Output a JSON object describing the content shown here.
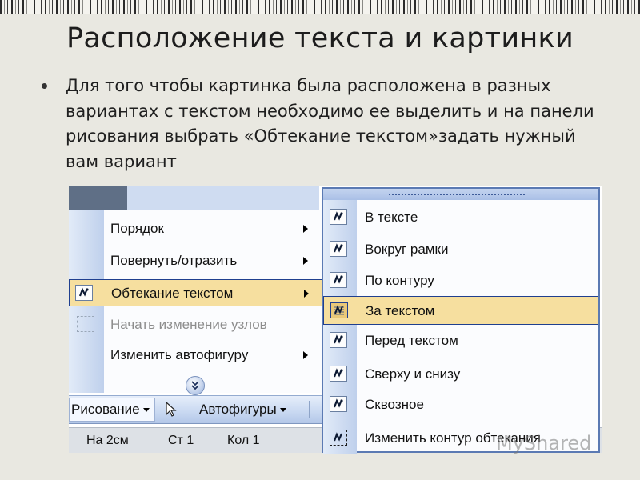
{
  "slide": {
    "title": "Расположение текста и картинки",
    "bullet": "Для того чтобы картинка была расположена в разных вариантах с текстом необходимо ее выделить и на панели рисования выбрать «Обтекание текстом»задать нужный вам вариант"
  },
  "context_menu": {
    "items": [
      {
        "label": "Порядок",
        "has_submenu": true,
        "enabled": true
      },
      {
        "label": "Повернуть/отразить",
        "has_submenu": true,
        "enabled": true
      },
      {
        "label": "Обтекание текстом",
        "has_submenu": true,
        "enabled": true,
        "selected": true
      },
      {
        "label": "Начать изменение узлов",
        "has_submenu": false,
        "enabled": false
      },
      {
        "label": "Изменить автофигуру",
        "has_submenu": true,
        "enabled": true
      }
    ],
    "expand_icon": "double-chevron-down-icon"
  },
  "toolbar": {
    "drawing_label": "Рисование",
    "autoshapes_label": "Автофигуры",
    "cursor_icon": "arrow-cursor-icon"
  },
  "statusbar": {
    "position": "На 2см",
    "line": "Ст 1",
    "column": "Кол 1"
  },
  "wrap_submenu": {
    "items": [
      {
        "label": "В тексте",
        "icon": "inline-wrap-icon"
      },
      {
        "label": "Вокруг рамки",
        "icon": "square-wrap-icon"
      },
      {
        "label": "По контуру",
        "icon": "tight-wrap-icon"
      },
      {
        "label": "За текстом",
        "icon": "behind-text-icon",
        "selected": true
      },
      {
        "label": "Перед текстом",
        "icon": "in-front-text-icon"
      },
      {
        "label": "Сверху и снизу",
        "icon": "top-bottom-wrap-icon"
      },
      {
        "label": "Сквозное",
        "icon": "through-wrap-icon"
      },
      {
        "label": "Изменить контур обтекания",
        "icon": "edit-wrap-points-icon"
      }
    ]
  },
  "watermark": "MyShared",
  "colors": {
    "selection": "#f6df9f",
    "selection_border": "#1f3f8f",
    "menu_border": "#5b7ab3"
  }
}
